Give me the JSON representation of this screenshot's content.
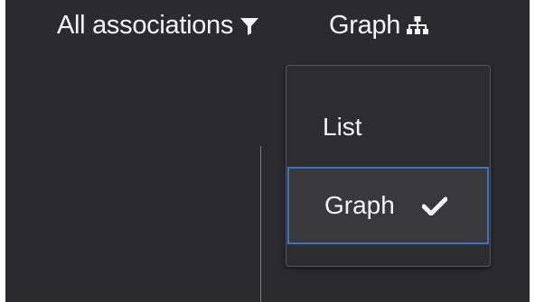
{
  "toolbar": {
    "filter_label": "All associations",
    "filter_icon": "filter-icon",
    "view_label": "Graph",
    "view_icon": "sitemap-icon"
  },
  "view_menu": {
    "options": [
      {
        "label": "List",
        "selected": false
      },
      {
        "label": "Graph",
        "selected": true,
        "icon": "checkmark-icon"
      }
    ]
  },
  "colors": {
    "background": "#2b2b2e",
    "menu_background": "#2d2d30",
    "selected_background": "#39393c",
    "selected_border": "#3b73c4",
    "text": "#f4f4f4"
  }
}
